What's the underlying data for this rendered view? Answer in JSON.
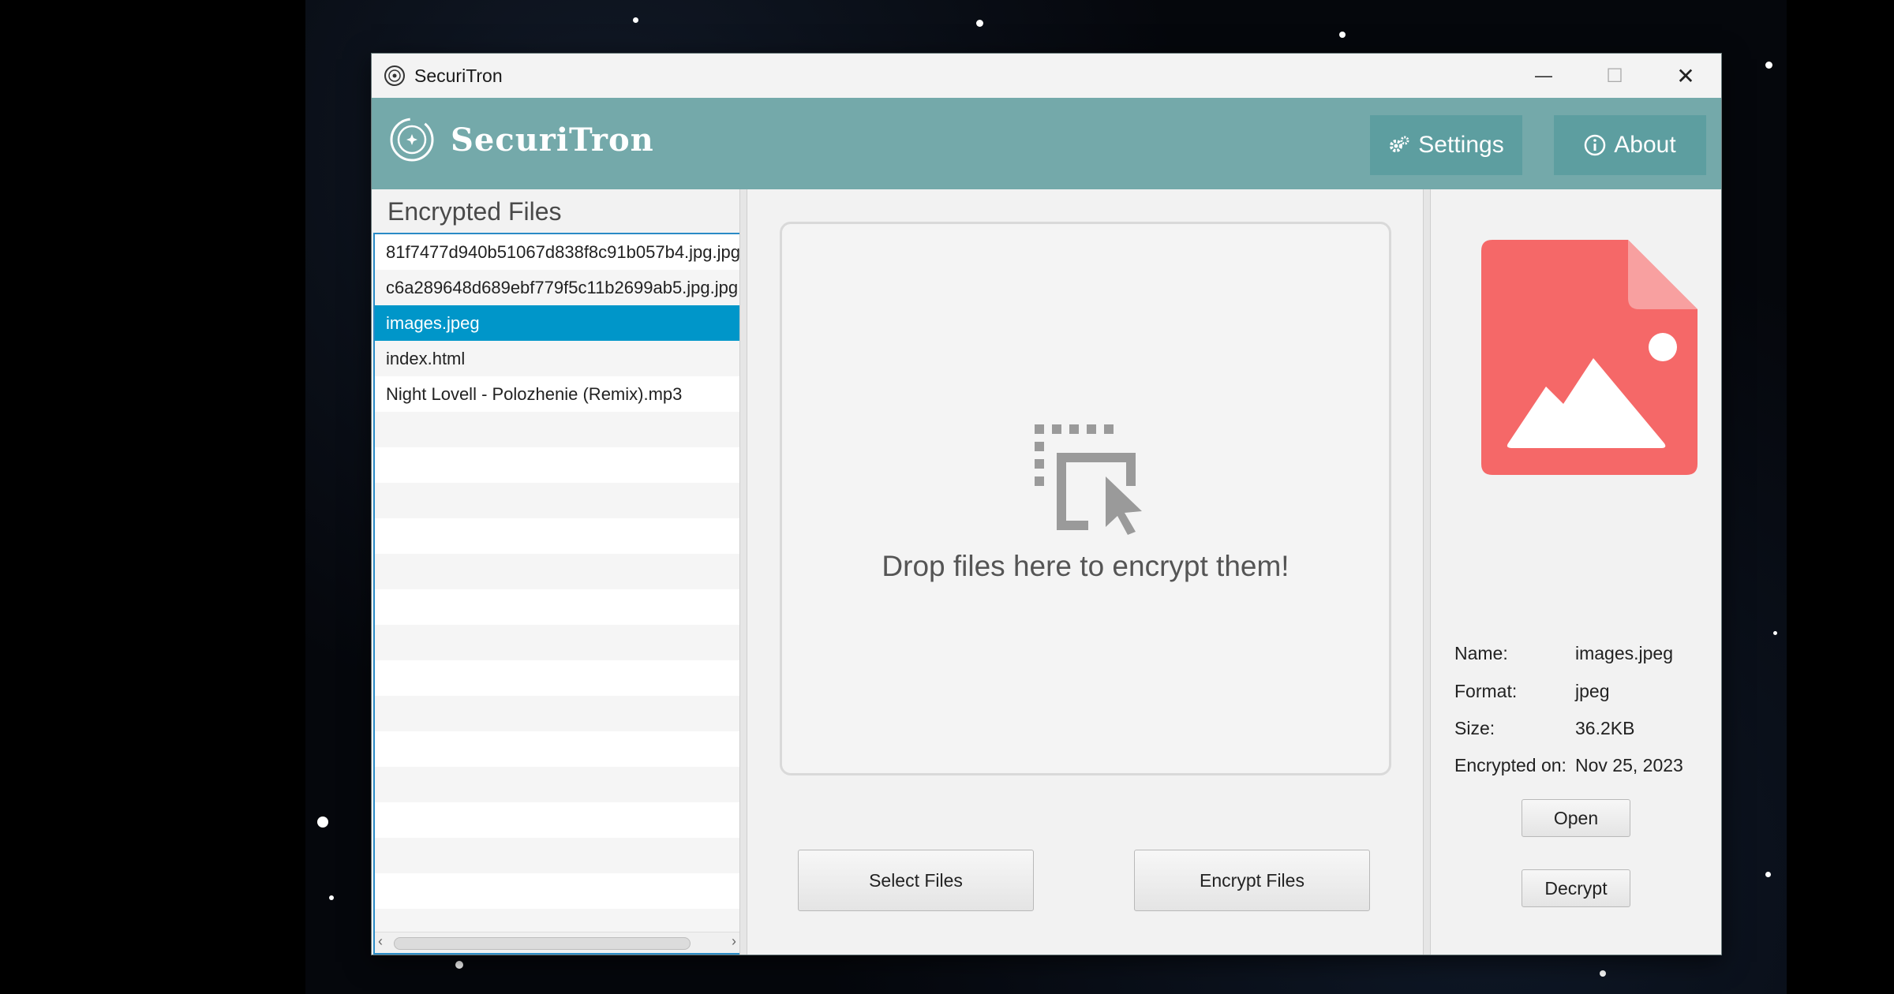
{
  "window": {
    "title": "SecuriTron",
    "minimize_glyph": "—",
    "maximize_glyph": "☐",
    "close_glyph": "✕"
  },
  "header": {
    "brand": "SecuriTron",
    "settings_label": "Settings",
    "about_label": "About",
    "settings_icon": "gears-icon",
    "about_icon": "info-icon"
  },
  "file_list": {
    "heading": "Encrypted Files",
    "items": [
      "81f7477d940b51067d838f8c91b057b4.jpg.jpg",
      "c6a289648d689ebf779f5c11b2699ab5.jpg.jpg",
      "images.jpeg",
      "index.html",
      "Night Lovell - Polozhenie (Remix).mp3"
    ],
    "selected_index": 2
  },
  "dropzone": {
    "text": "Drop files here to encrypt them!",
    "icon": "drop-files-icon"
  },
  "actions": {
    "select_label": "Select Files",
    "encrypt_label": "Encrypt Files"
  },
  "details": {
    "preview_icon": "image-file-icon",
    "name_label": "Name:",
    "name_value": "images.jpeg",
    "format_label": "Format:",
    "format_value": "jpeg",
    "size_label": "Size:",
    "size_value": "36.2KB",
    "encrypted_label": "Encrypted on:",
    "encrypted_value": "Nov 25, 2023",
    "open_label": "Open",
    "decrypt_label": "Decrypt"
  },
  "colors": {
    "header": "#74a9aa",
    "header_button": "#5d9ea0",
    "selection": "#0096c9",
    "file_icon": "#f56868"
  }
}
